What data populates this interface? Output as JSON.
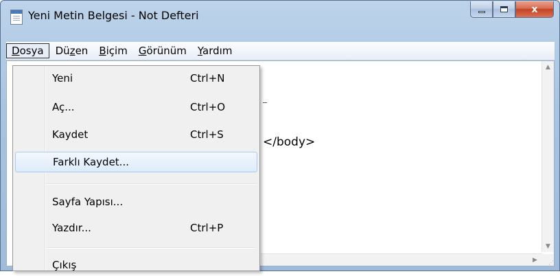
{
  "window": {
    "title": "Yeni Metin Belgesi - Not Defteri",
    "caption_close": "x"
  },
  "menubar": {
    "items": [
      {
        "pre": "",
        "ul": "D",
        "post": "osya"
      },
      {
        "pre": "Dü",
        "ul": "z",
        "post": "en"
      },
      {
        "pre": "",
        "ul": "B",
        "post": "içim"
      },
      {
        "pre": "",
        "ul": "G",
        "post": "örünüm"
      },
      {
        "pre": "",
        "ul": "Y",
        "post": "ardım"
      }
    ]
  },
  "editor": {
    "visible_text": "</body>"
  },
  "file_menu": {
    "items": [
      {
        "label": "Yeni",
        "shortcut": "Ctrl+N"
      },
      {
        "label": "Aç...",
        "shortcut": "Ctrl+O"
      },
      {
        "label": "Kaydet",
        "shortcut": "Ctrl+S"
      },
      {
        "label": "Farklı Kaydet...",
        "shortcut": ""
      },
      {
        "label": "Sayfa Yapısı...",
        "shortcut": ""
      },
      {
        "label": "Yazdır...",
        "shortcut": "Ctrl+P"
      },
      {
        "label": "Çıkış",
        "shortcut": ""
      }
    ],
    "highlighted": "Farklı Kaydet..."
  }
}
